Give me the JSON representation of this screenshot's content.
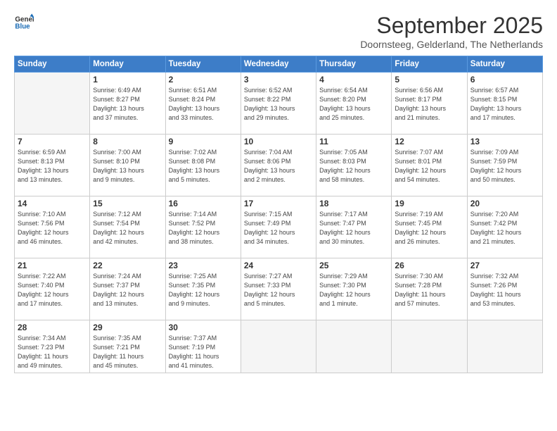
{
  "logo": {
    "line1": "General",
    "line2": "Blue"
  },
  "title": "September 2025",
  "subtitle": "Doornsteeg, Gelderland, The Netherlands",
  "days_header": [
    "Sunday",
    "Monday",
    "Tuesday",
    "Wednesday",
    "Thursday",
    "Friday",
    "Saturday"
  ],
  "weeks": [
    [
      {
        "day": "",
        "info": ""
      },
      {
        "day": "1",
        "info": "Sunrise: 6:49 AM\nSunset: 8:27 PM\nDaylight: 13 hours\nand 37 minutes."
      },
      {
        "day": "2",
        "info": "Sunrise: 6:51 AM\nSunset: 8:24 PM\nDaylight: 13 hours\nand 33 minutes."
      },
      {
        "day": "3",
        "info": "Sunrise: 6:52 AM\nSunset: 8:22 PM\nDaylight: 13 hours\nand 29 minutes."
      },
      {
        "day": "4",
        "info": "Sunrise: 6:54 AM\nSunset: 8:20 PM\nDaylight: 13 hours\nand 25 minutes."
      },
      {
        "day": "5",
        "info": "Sunrise: 6:56 AM\nSunset: 8:17 PM\nDaylight: 13 hours\nand 21 minutes."
      },
      {
        "day": "6",
        "info": "Sunrise: 6:57 AM\nSunset: 8:15 PM\nDaylight: 13 hours\nand 17 minutes."
      }
    ],
    [
      {
        "day": "7",
        "info": "Sunrise: 6:59 AM\nSunset: 8:13 PM\nDaylight: 13 hours\nand 13 minutes."
      },
      {
        "day": "8",
        "info": "Sunrise: 7:00 AM\nSunset: 8:10 PM\nDaylight: 13 hours\nand 9 minutes."
      },
      {
        "day": "9",
        "info": "Sunrise: 7:02 AM\nSunset: 8:08 PM\nDaylight: 13 hours\nand 5 minutes."
      },
      {
        "day": "10",
        "info": "Sunrise: 7:04 AM\nSunset: 8:06 PM\nDaylight: 13 hours\nand 2 minutes."
      },
      {
        "day": "11",
        "info": "Sunrise: 7:05 AM\nSunset: 8:03 PM\nDaylight: 12 hours\nand 58 minutes."
      },
      {
        "day": "12",
        "info": "Sunrise: 7:07 AM\nSunset: 8:01 PM\nDaylight: 12 hours\nand 54 minutes."
      },
      {
        "day": "13",
        "info": "Sunrise: 7:09 AM\nSunset: 7:59 PM\nDaylight: 12 hours\nand 50 minutes."
      }
    ],
    [
      {
        "day": "14",
        "info": "Sunrise: 7:10 AM\nSunset: 7:56 PM\nDaylight: 12 hours\nand 46 minutes."
      },
      {
        "day": "15",
        "info": "Sunrise: 7:12 AM\nSunset: 7:54 PM\nDaylight: 12 hours\nand 42 minutes."
      },
      {
        "day": "16",
        "info": "Sunrise: 7:14 AM\nSunset: 7:52 PM\nDaylight: 12 hours\nand 38 minutes."
      },
      {
        "day": "17",
        "info": "Sunrise: 7:15 AM\nSunset: 7:49 PM\nDaylight: 12 hours\nand 34 minutes."
      },
      {
        "day": "18",
        "info": "Sunrise: 7:17 AM\nSunset: 7:47 PM\nDaylight: 12 hours\nand 30 minutes."
      },
      {
        "day": "19",
        "info": "Sunrise: 7:19 AM\nSunset: 7:45 PM\nDaylight: 12 hours\nand 26 minutes."
      },
      {
        "day": "20",
        "info": "Sunrise: 7:20 AM\nSunset: 7:42 PM\nDaylight: 12 hours\nand 21 minutes."
      }
    ],
    [
      {
        "day": "21",
        "info": "Sunrise: 7:22 AM\nSunset: 7:40 PM\nDaylight: 12 hours\nand 17 minutes."
      },
      {
        "day": "22",
        "info": "Sunrise: 7:24 AM\nSunset: 7:37 PM\nDaylight: 12 hours\nand 13 minutes."
      },
      {
        "day": "23",
        "info": "Sunrise: 7:25 AM\nSunset: 7:35 PM\nDaylight: 12 hours\nand 9 minutes."
      },
      {
        "day": "24",
        "info": "Sunrise: 7:27 AM\nSunset: 7:33 PM\nDaylight: 12 hours\nand 5 minutes."
      },
      {
        "day": "25",
        "info": "Sunrise: 7:29 AM\nSunset: 7:30 PM\nDaylight: 12 hours\nand 1 minute."
      },
      {
        "day": "26",
        "info": "Sunrise: 7:30 AM\nSunset: 7:28 PM\nDaylight: 11 hours\nand 57 minutes."
      },
      {
        "day": "27",
        "info": "Sunrise: 7:32 AM\nSunset: 7:26 PM\nDaylight: 11 hours\nand 53 minutes."
      }
    ],
    [
      {
        "day": "28",
        "info": "Sunrise: 7:34 AM\nSunset: 7:23 PM\nDaylight: 11 hours\nand 49 minutes."
      },
      {
        "day": "29",
        "info": "Sunrise: 7:35 AM\nSunset: 7:21 PM\nDaylight: 11 hours\nand 45 minutes."
      },
      {
        "day": "30",
        "info": "Sunrise: 7:37 AM\nSunset: 7:19 PM\nDaylight: 11 hours\nand 41 minutes."
      },
      {
        "day": "",
        "info": ""
      },
      {
        "day": "",
        "info": ""
      },
      {
        "day": "",
        "info": ""
      },
      {
        "day": "",
        "info": ""
      }
    ]
  ]
}
